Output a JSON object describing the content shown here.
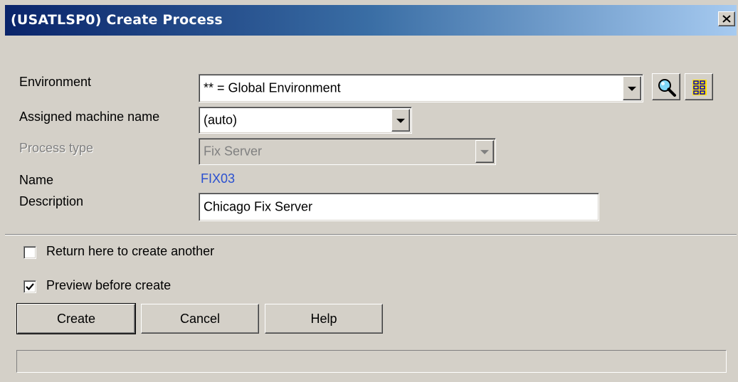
{
  "window": {
    "title": "(USATLSP0) Create Process",
    "close_icon": "close-icon"
  },
  "form": {
    "environment": {
      "label": "Environment",
      "value": "** = Global Environment"
    },
    "machine": {
      "label": "Assigned machine name",
      "value": "(auto)"
    },
    "process_type": {
      "label": "Process type",
      "value": "Fix Server",
      "disabled": true
    },
    "name": {
      "label": "Name",
      "value": "FIX03"
    },
    "description": {
      "label": "Description",
      "value": "Chicago Fix Server"
    },
    "tools": [
      "search-icon",
      "tree-view-icon"
    ]
  },
  "options": {
    "return_here": {
      "label": "Return here to create another",
      "checked": false
    },
    "preview": {
      "label": "Preview before create",
      "checked": true
    }
  },
  "buttons": {
    "create": "Create",
    "cancel": "Cancel",
    "help": "Help"
  },
  "status": {
    "text": ""
  },
  "colors": {
    "window_bg": "#d4d0c8",
    "title_start": "#0a246a",
    "title_end": "#a6caf0",
    "name_value": "#2a50d0"
  }
}
